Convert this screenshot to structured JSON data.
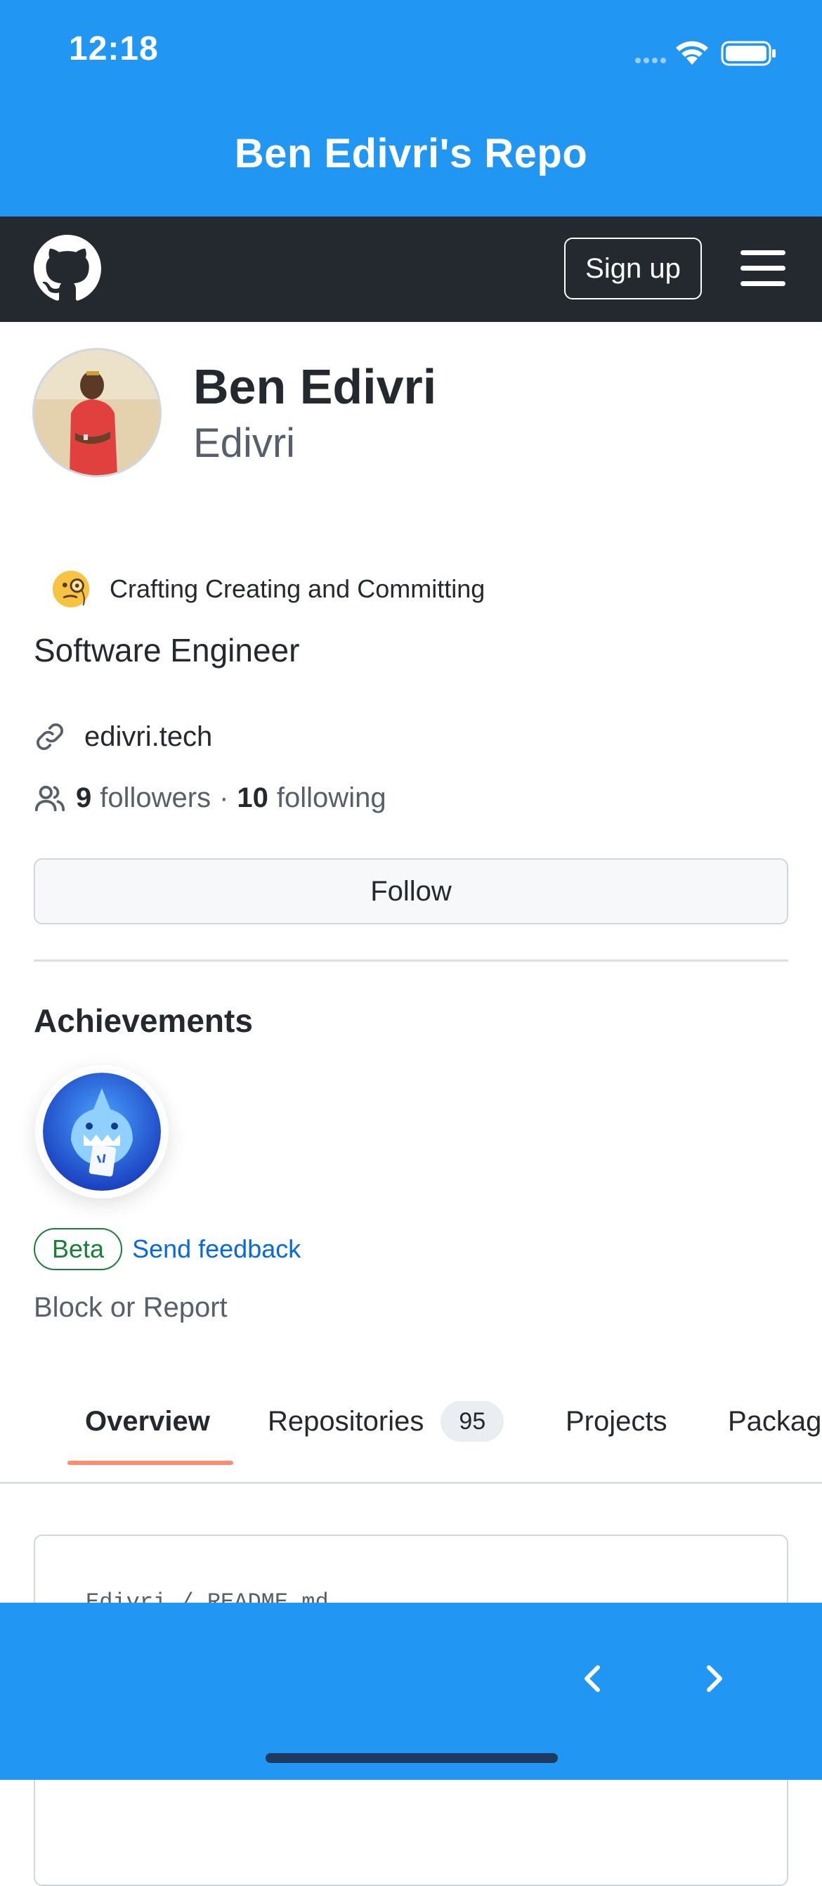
{
  "status_bar": {
    "time": "12:18"
  },
  "app": {
    "title": "Ben Edivri's Repo"
  },
  "github_nav": {
    "signup_label": "Sign up"
  },
  "profile": {
    "name": "Ben Edivri",
    "login": "Edivri",
    "status": "Crafting Creating and Committing",
    "bio": "Software Engineer",
    "website": "edivri.tech",
    "followers_count": "9",
    "followers_label": "followers",
    "separator": "·",
    "following_count": "10",
    "following_label": "following",
    "follow_button": "Follow"
  },
  "achievements": {
    "title": "Achievements",
    "beta_label": "Beta",
    "feedback_link": "Send feedback"
  },
  "block_report": "Block or Report",
  "tabs": [
    {
      "label": "Overview",
      "active": true
    },
    {
      "label": "Repositories",
      "count": "95"
    },
    {
      "label": "Projects"
    },
    {
      "label": "Packages"
    }
  ],
  "readme": {
    "path": "Edivri / README.md"
  },
  "colors": {
    "app_blue": "#2196f3",
    "github_dark": "#24292f",
    "link_blue": "#0969da",
    "beta_green": "#1a7f37",
    "tab_underline": "#fd8c73"
  },
  "icons": [
    "wifi-icon",
    "battery-icon",
    "signal-icon",
    "github-logo-icon",
    "menu-icon",
    "monocle-emoji-icon",
    "link-icon",
    "people-icon",
    "achievement-badge-icon",
    "chevron-left-icon",
    "chevron-right-icon"
  ]
}
